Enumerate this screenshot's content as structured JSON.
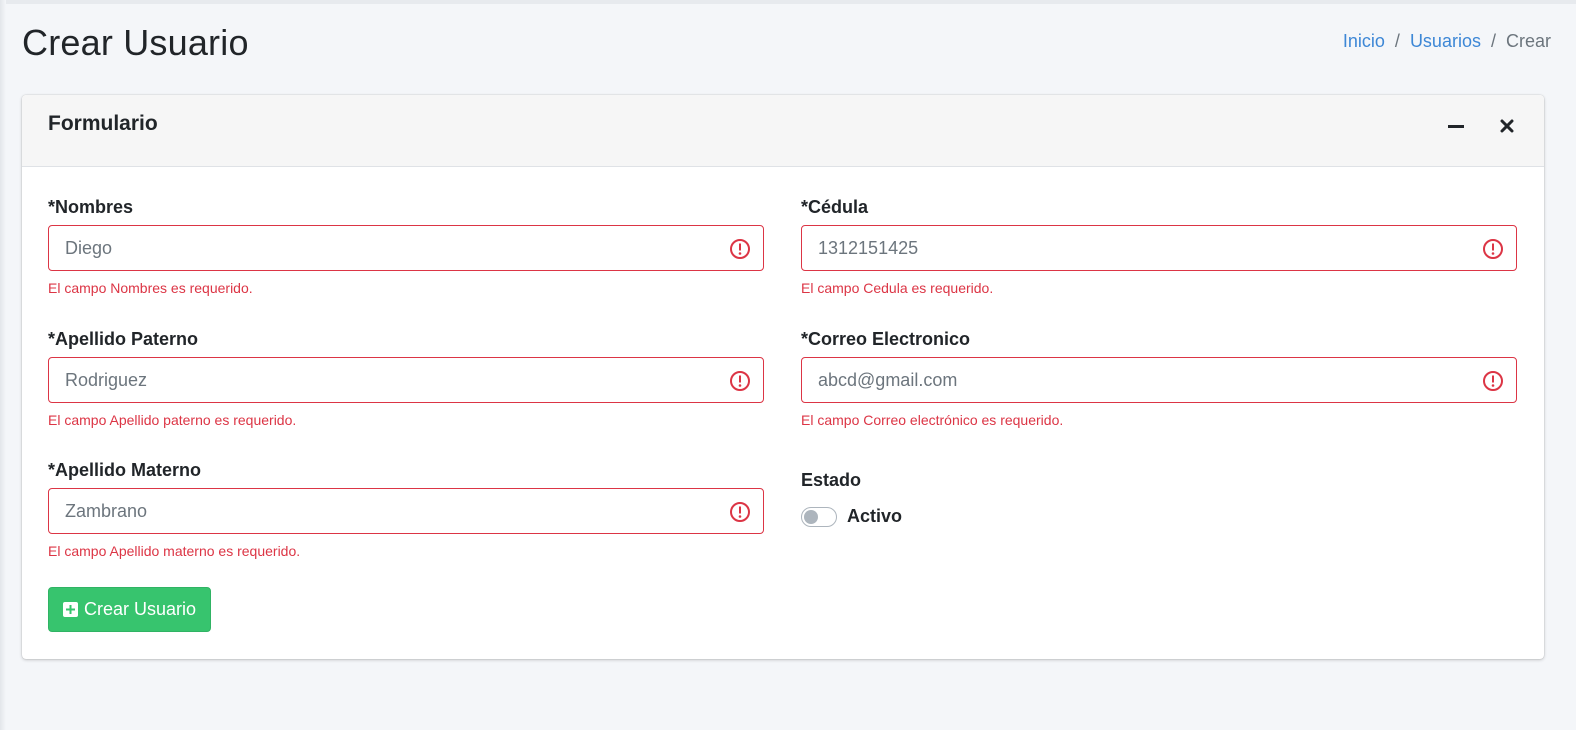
{
  "page": {
    "title": "Crear Usuario"
  },
  "breadcrumb": {
    "items": [
      "Inicio",
      "Usuarios",
      "Crear"
    ],
    "separator": "/"
  },
  "card": {
    "title": "Formulario"
  },
  "form": {
    "nombres": {
      "label": "*Nombres",
      "placeholder": "Diego",
      "error": "El campo Nombres es requerido."
    },
    "apellido_paterno": {
      "label": "*Apellido Paterno",
      "placeholder": "Rodriguez",
      "error": "El campo Apellido paterno es requerido."
    },
    "apellido_materno": {
      "label": "*Apellido Materno",
      "placeholder": "Zambrano",
      "error": "El campo Apellido materno es requerido."
    },
    "cedula": {
      "label": "*Cédula",
      "placeholder": "1312151425",
      "error": "El campo Cedula es requerido."
    },
    "correo": {
      "label": "*Correo Electronico",
      "placeholder": "abcd@gmail.com",
      "error": "El campo Correo electrónico es requerido."
    },
    "estado": {
      "label": "Estado",
      "switch_label": "Activo",
      "checked": false
    },
    "submit_label": "Crear Usuario"
  },
  "colors": {
    "error": "#dc3545",
    "success": "#37c46e",
    "link": "#3d87d6"
  },
  "icons": {
    "minimize": "minus-icon",
    "close": "close-icon",
    "error": "exclamation-circle-icon",
    "submit": "plus-square-icon"
  }
}
